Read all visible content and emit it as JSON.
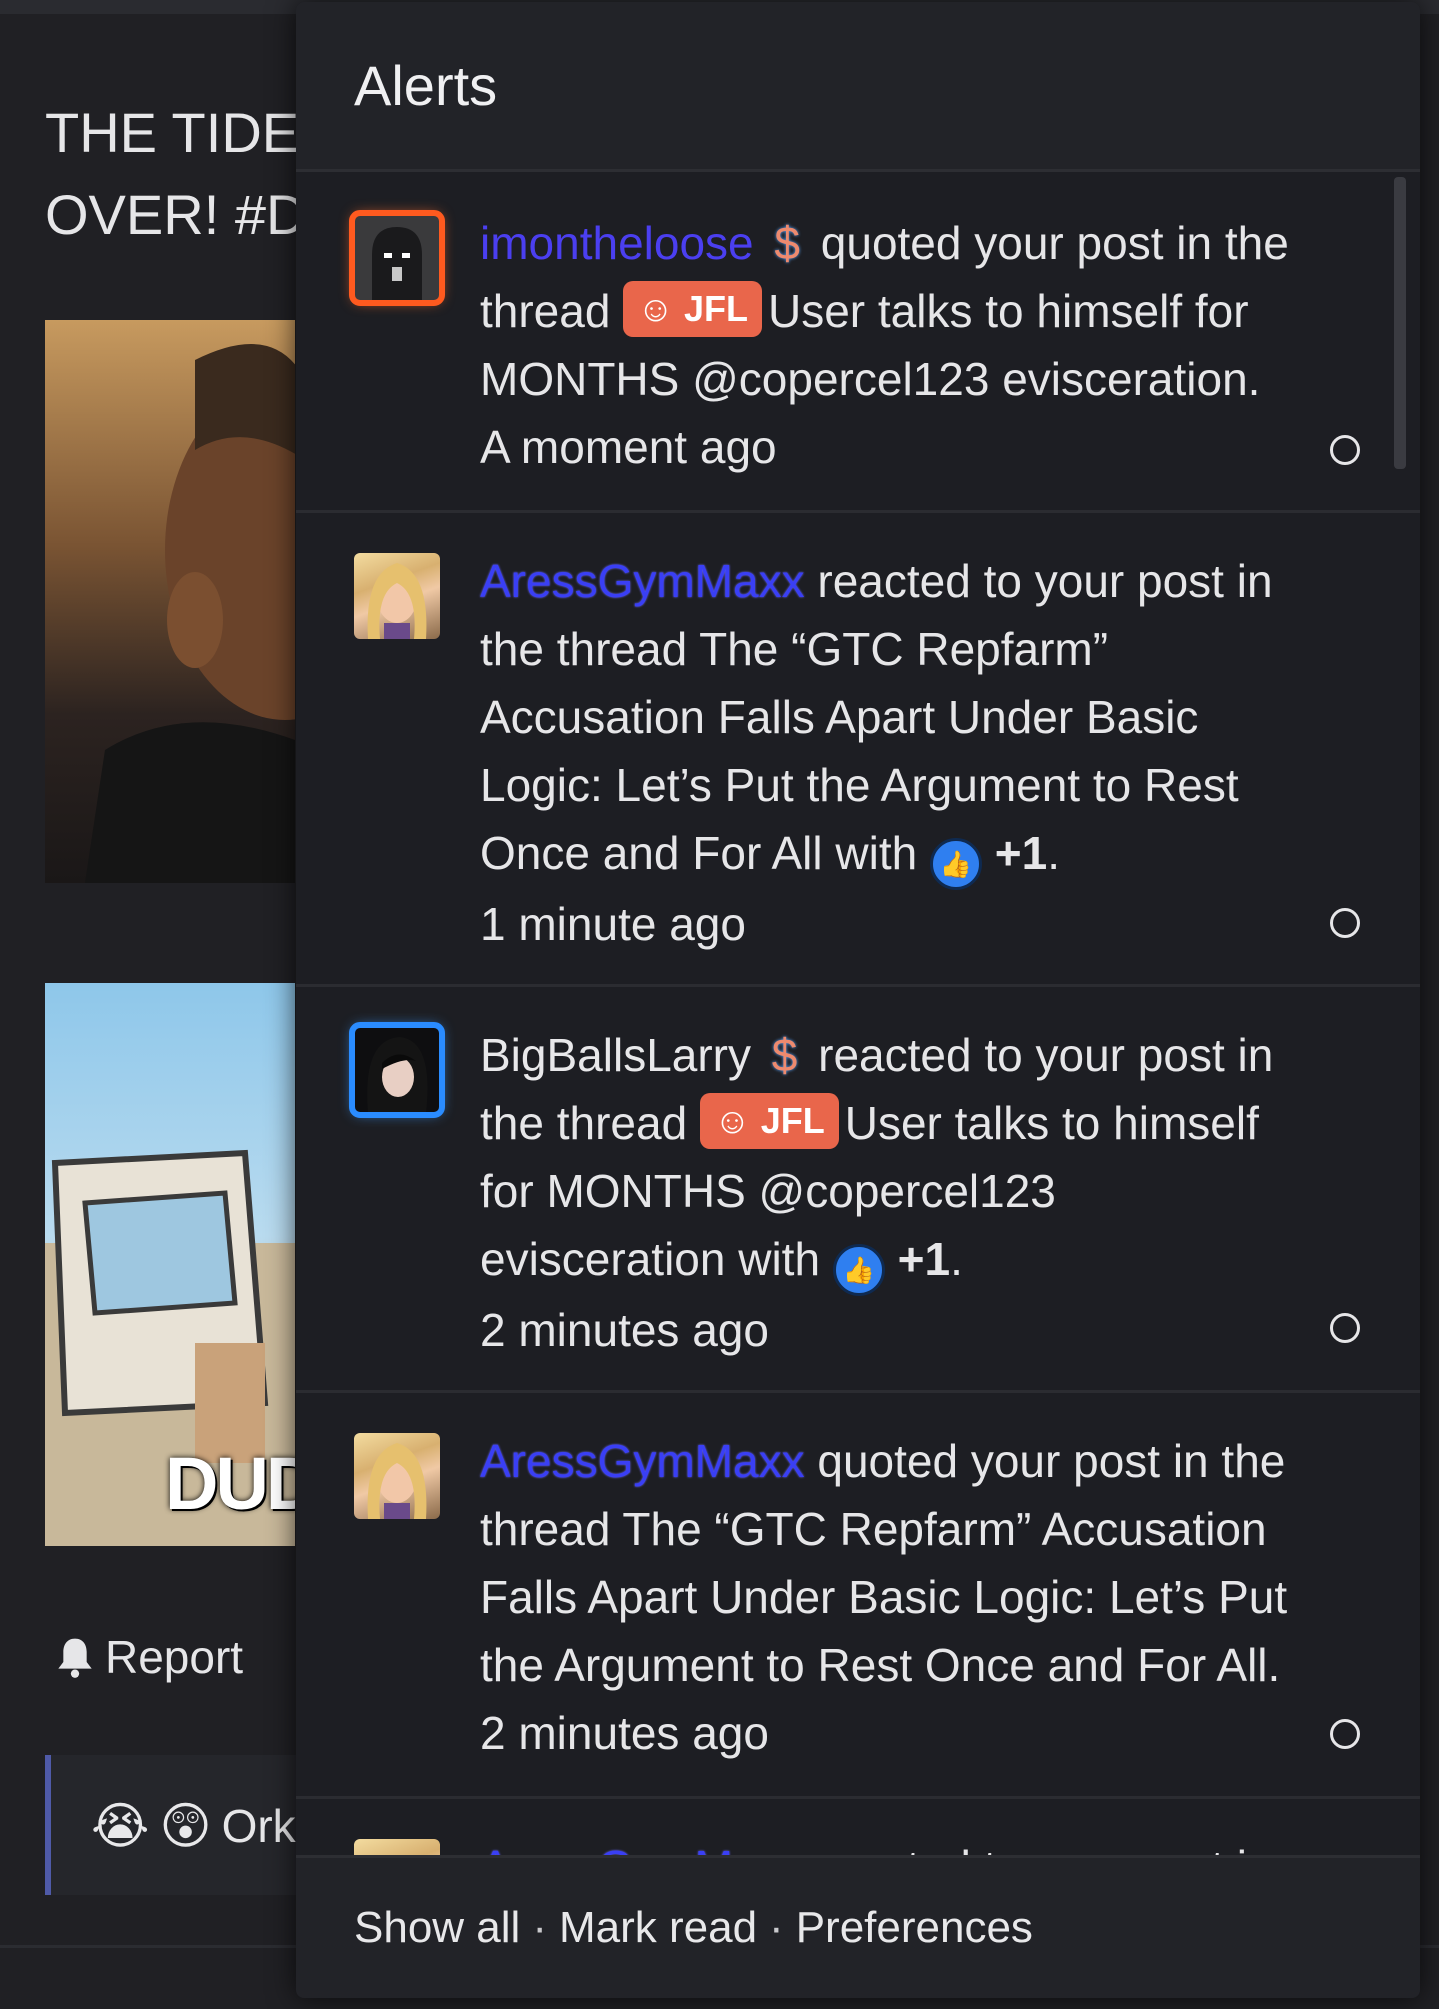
{
  "background": {
    "post_title_line1": "THE TIDES",
    "post_title_line2": "OVER! #DI",
    "image2_caption": "DUDE",
    "report_label": "Report",
    "reactions_emoji": [
      "😭",
      "😲"
    ],
    "reactions_text": "Ork"
  },
  "panel": {
    "title": "Alerts",
    "alerts": [
      {
        "user": "imontheloose",
        "premium": "$",
        "action": "quoted your post in the thread",
        "tag": "JFL",
        "thread": "User talks to himself for MONTHS @copercel123 evisceration.",
        "time": "A moment ago",
        "avatar": "orange-frame-avatar"
      },
      {
        "user": "AressGymMaxx",
        "action": "reacted to your post in the thread",
        "thread": "The “GTC Repfarm” Accusation Falls Apart Under Basic Logic: Let’s Put the Argument to Rest Once and For All",
        "with": "with",
        "reaction": "+1",
        "end": ".",
        "time": "1 minute ago"
      },
      {
        "user": "BigBallsLarry",
        "premium": "$",
        "action": "reacted to your post in the thread",
        "tag": "JFL",
        "thread": "User talks to himself for MONTHS @copercel123 evisceration",
        "with": "with",
        "reaction": "+1",
        "end": ".",
        "time": "2 minutes ago"
      },
      {
        "user": "AressGymMaxx",
        "action": "quoted your post in the thread",
        "thread": "The “GTC Repfarm” Accusation Falls Apart Under Basic Logic: Let’s Put the Argument to Rest Once and For All.",
        "time": "2 minutes ago"
      },
      {
        "user": "AressGymMaxx",
        "action": "reacted to your post in"
      }
    ]
  },
  "footer": {
    "show_all": "Show all",
    "separator": "·",
    "mark_read": "Mark read",
    "preferences": "Preferences"
  },
  "colors": {
    "page_bg": "#202024",
    "panel_bg": "#1d1e23",
    "username_link": "#3a3ff5",
    "tag_bg": "#e9664b",
    "like_blue": "#2f7ff0",
    "orange_frame": "#ff5a1f",
    "blue_frame": "#2a8cff"
  }
}
